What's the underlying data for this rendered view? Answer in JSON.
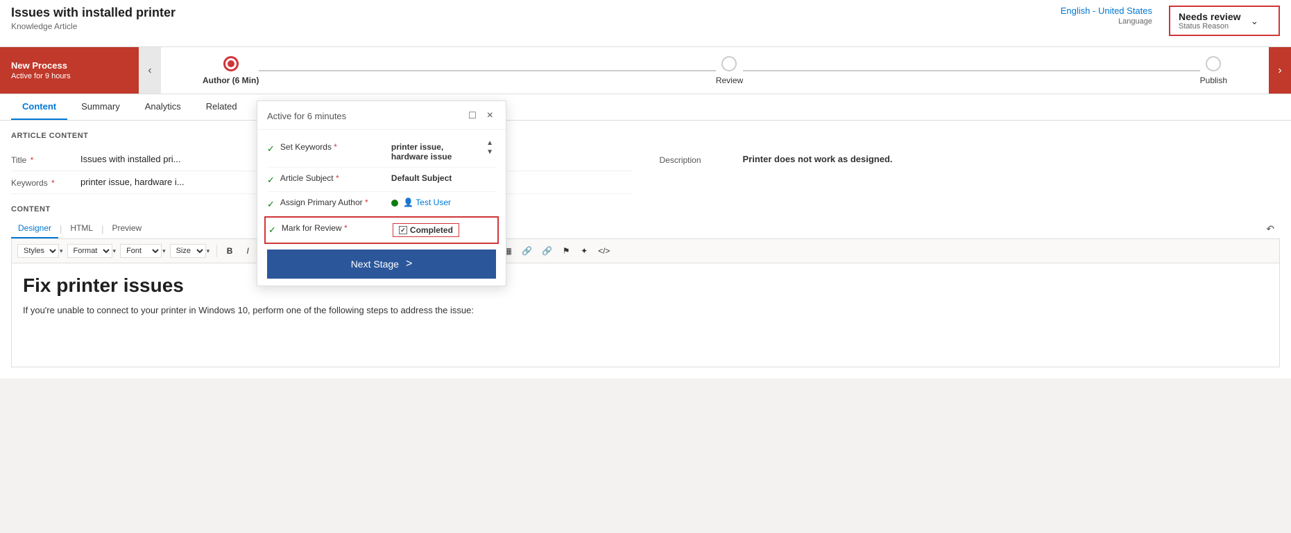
{
  "header": {
    "title": "Issues with installed printer",
    "subtitle": "Knowledge Article",
    "language": {
      "value": "English - United States",
      "label": "Language"
    },
    "status": {
      "value": "Needs review",
      "label": "Status Reason"
    }
  },
  "process": {
    "name": "New Process",
    "time": "Active for 9 hours",
    "stages": [
      {
        "label": "Author (6 Min)",
        "state": "active"
      },
      {
        "label": "Review",
        "state": "inactive"
      },
      {
        "label": "Publish",
        "state": "inactive"
      }
    ]
  },
  "tabs": [
    {
      "label": "Content",
      "active": true
    },
    {
      "label": "Summary",
      "active": false
    },
    {
      "label": "Analytics",
      "active": false
    },
    {
      "label": "Related",
      "active": false
    }
  ],
  "articleContent": {
    "sectionTitle": "ARTICLE CONTENT",
    "fields": [
      {
        "label": "Title",
        "required": true,
        "value": "Issues with installed pri..."
      },
      {
        "label": "Keywords",
        "required": true,
        "value": "printer issue, hardware i..."
      }
    ],
    "description": {
      "label": "Description",
      "value": "Printer does not work as designed."
    }
  },
  "contentSection": {
    "title": "CONTENT",
    "editorTabs": [
      "Designer",
      "HTML",
      "Preview"
    ],
    "toolbar": {
      "styles": "Styles",
      "format": "Format",
      "font": "Font",
      "size": "Size"
    },
    "editorHeading": "Fix printer issues",
    "editorBody": "If you're unable to connect to your printer in Windows 10, perform one of the following steps to address the issue:"
  },
  "popup": {
    "title": "Active for 6 minutes",
    "rows": [
      {
        "checked": true,
        "label": "Set Keywords",
        "required": true,
        "value": "printer issue, hardware issue",
        "valueType": "text-bold"
      },
      {
        "checked": true,
        "label": "Article Subject",
        "required": true,
        "value": "Default Subject",
        "valueType": "text-bold"
      },
      {
        "checked": true,
        "label": "Assign Primary Author",
        "required": true,
        "value": "Test User",
        "valueType": "user-link"
      },
      {
        "checked": true,
        "label": "Mark for Review",
        "required": true,
        "value": "Completed",
        "valueType": "completed",
        "highlighted": true
      }
    ],
    "nextStageLabel": "Next Stage"
  }
}
